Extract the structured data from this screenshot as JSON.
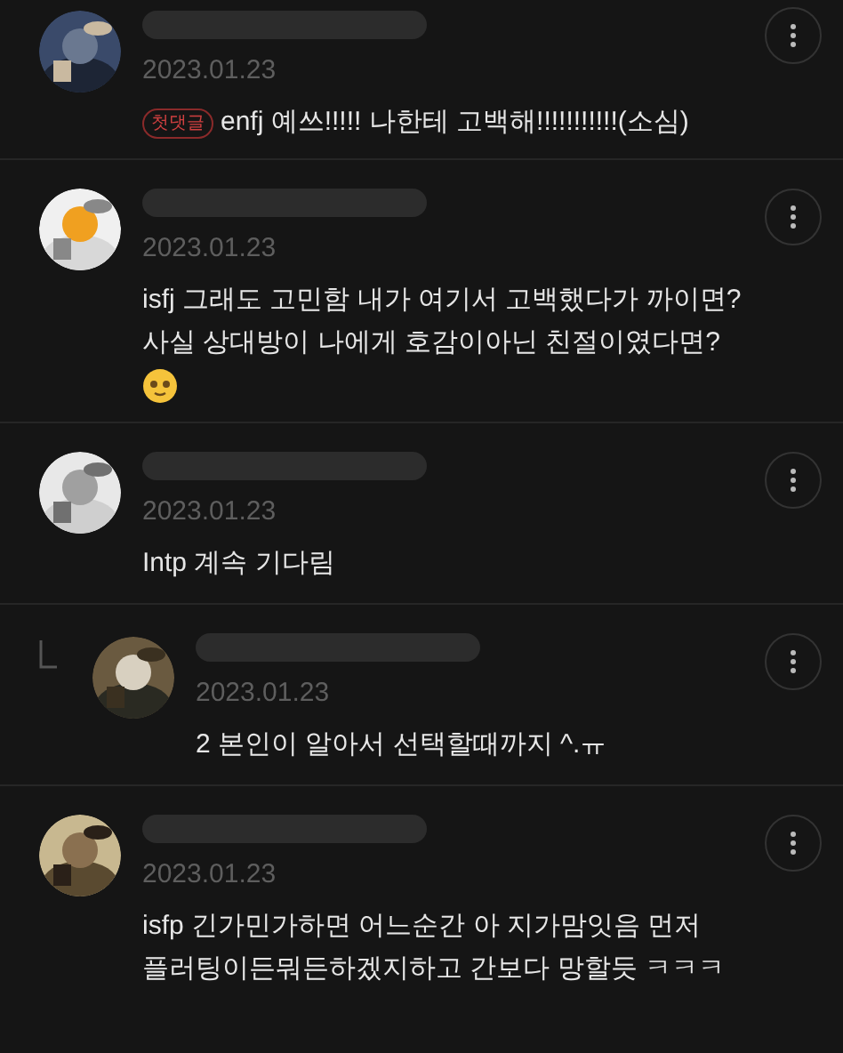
{
  "comments": [
    {
      "kind": "comment",
      "date": "2023.01.23",
      "badge": "첫댓글",
      "text": "enfj 예쓰!!!!! 나한테 고백해!!!!!!!!!!!(소심)"
    },
    {
      "kind": "comment",
      "date": "2023.01.23",
      "text": "isfj 그래도 고민함 내가 여기서 고백했다가 까이면?\n사실 상대방이 나에게 호감이아닌 친절이였다면?",
      "emoji": true
    },
    {
      "kind": "comment",
      "date": "2023.01.23",
      "text": "Intp 계속 기다림"
    },
    {
      "kind": "reply",
      "date": "2023.01.23",
      "text": "2 본인이 알아서 선택할때까지 ^.ㅠ"
    },
    {
      "kind": "comment",
      "date": "2023.01.23",
      "text": "isfp 긴가민가하면 어느순간 아 지가맘잇음 먼저\n플러팅이든뭐든하겠지하고 간보다 망할듯 ㅋㅋㅋ"
    }
  ]
}
